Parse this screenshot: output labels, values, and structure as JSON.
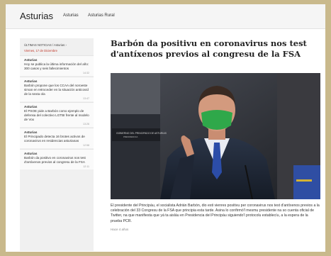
{
  "header": {
    "site_title": "Asturias",
    "nav": [
      "Asturias",
      "Asturias Rural"
    ]
  },
  "sidebar": {
    "heading": "ÚLTIMAS NOTICIAS / Asturias ›",
    "date": "Viernes, 17 de Diciembre",
    "items": [
      {
        "category": "Asturias",
        "title": "Hoy se publica la última información del año: 300 casos y seis fallecimientos",
        "time": "14:32"
      },
      {
        "category": "Asturias",
        "title": "Barbón propone que los CCAA del noroeste sirvan en retroceder en la situación anticovid de la sexta ola",
        "time": "13:47"
      },
      {
        "category": "Asturias",
        "title": "El PSOE pide a Barbón como ejemplo de defensa del colectivo LGTBI frente al modelo de Vox",
        "time": "13:26"
      },
      {
        "category": "Asturias",
        "title": "El Principado detecta 16 brotes activos de coronavirus en residencias asturianas",
        "time": "12:58"
      },
      {
        "category": "Asturias",
        "title": "Barbón da positivo en coronavirus nos test d'antíxenos previos al congresu de la FSA",
        "time": "12:11"
      }
    ]
  },
  "article": {
    "headline": "Barbón da positivu en coronavirus nos test d'antíxenos previos al congresu de la FSA",
    "podium_text": "GOBIERNO DEL PRINCIPADO DE ASTURIAS",
    "podium_sub": "PRESIDENCIA",
    "caption": "El presidente del Principáu, el socialista Adrián Barbón, dio esti vienres positivu per coronavirus nos test d'antíxenos previos a la celebración del 33 Congresu de la FSA que principia esta tarde. Asina lo confirmó'l mesmu presidente na so cuenta oficial de Twitter, na que manifiesta que yá ta aisláu en Presidencia del Principáu siguiendo'l protocolu establecíu, a la espera de la prueba PCR.",
    "meta": "Hace 4 años"
  }
}
